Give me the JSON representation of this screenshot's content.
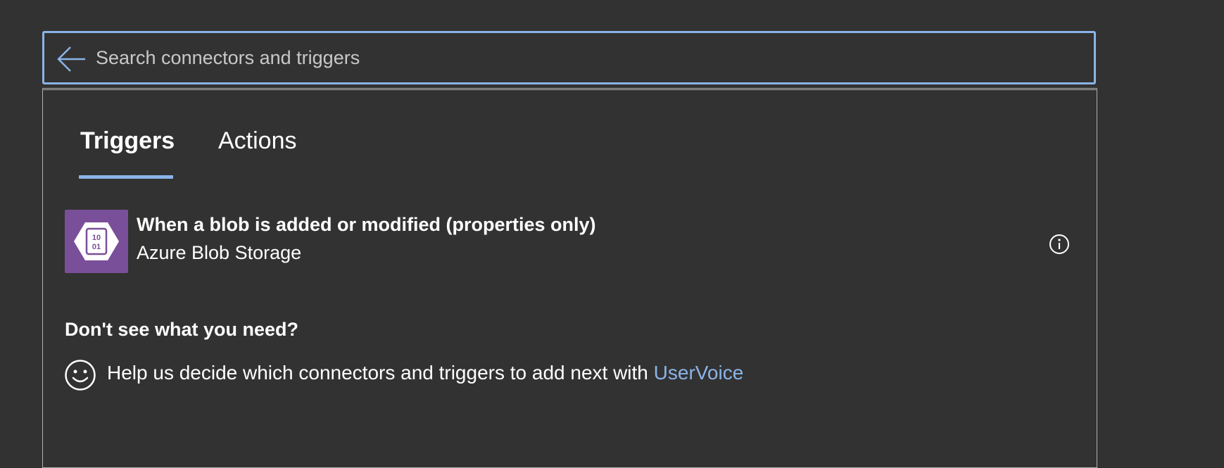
{
  "search": {
    "placeholder": "Search connectors and triggers",
    "value": ""
  },
  "tabs": [
    {
      "label": "Triggers",
      "selected": true
    },
    {
      "label": "Actions",
      "selected": false
    }
  ],
  "triggers": [
    {
      "title": "When a blob is added or modified (properties only)",
      "connector": "Azure Blob Storage",
      "icon": "azure-blob-storage-icon",
      "icon_color": "#7a4f99"
    }
  ],
  "help": {
    "heading": "Don't see what you need?",
    "text": "Help us decide which connectors and triggers to add next with ",
    "link_label": "UserVoice"
  },
  "colors": {
    "background": "#323232",
    "accent": "#8ab4e8",
    "connector": "#7a4f99"
  }
}
